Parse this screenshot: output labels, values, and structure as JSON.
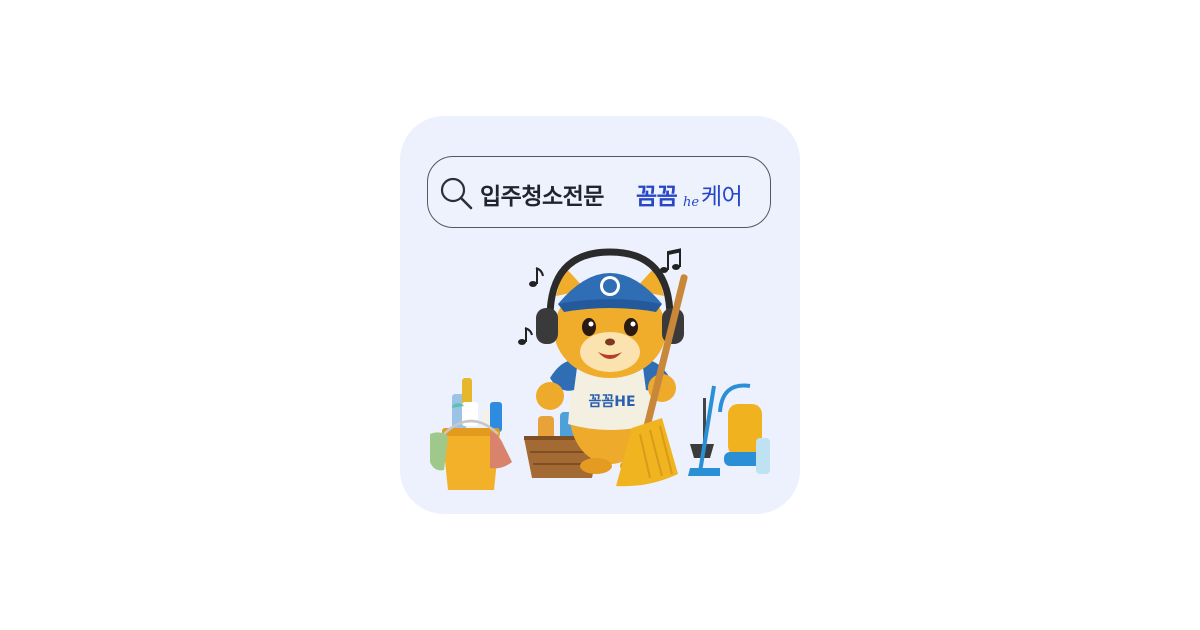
{
  "card": {
    "background": "#edf1fd",
    "search": {
      "query_main": "입주청소전문",
      "brand_part1": "꼼꼼",
      "brand_he": "he",
      "brand_part2": "케어",
      "brand_color": "#2747c7"
    },
    "mascot": {
      "shirt_text": "꼼꼼HE"
    }
  }
}
